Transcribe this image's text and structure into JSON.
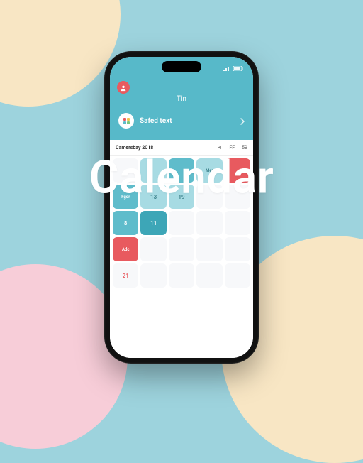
{
  "hero": "Calendar",
  "status": {
    "left": "",
    "signal": "sig",
    "wifi": "wifi",
    "battery": "bat"
  },
  "header": {
    "title": "Tin",
    "card_label": "Safed text"
  },
  "calendar": {
    "label": "Camersbay 2018",
    "col_a": "FF",
    "col_b": "59"
  },
  "cells": {
    "r1c4": "Mer",
    "r2c1": "Fgor",
    "r2c2": "13",
    "r2c3": "19",
    "r3c1": "8",
    "r3c2": "11",
    "r4c1": "Adc",
    "r5c1": "21"
  }
}
